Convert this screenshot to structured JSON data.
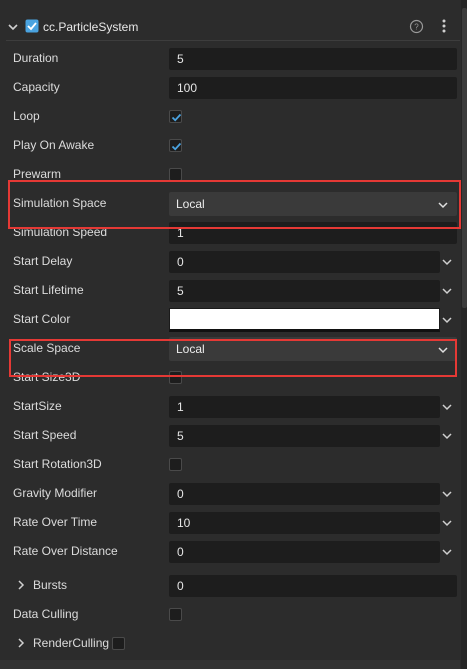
{
  "component": {
    "title": "cc.ParticleSystem",
    "enabled": true
  },
  "icons": {
    "collapse": "chevron-down-icon",
    "help": "help-circle-icon",
    "more": "vertical-ellipsis-icon"
  },
  "colors": {
    "highlight": "#e53935",
    "check": "#4aa3e0",
    "field_bg": "#1d1d1d",
    "select_bg": "#3a3a3a"
  },
  "props": {
    "duration": {
      "label": "Duration",
      "value": "5"
    },
    "capacity": {
      "label": "Capacity",
      "value": "100"
    },
    "loop": {
      "label": "Loop",
      "checked": true
    },
    "play_on_awake": {
      "label": "Play On Awake",
      "checked": true
    },
    "prewarm": {
      "label": "Prewarm",
      "checked": false
    },
    "simulation_space": {
      "label": "Simulation Space",
      "value": "Local"
    },
    "simulation_speed": {
      "label": "Simulation Speed",
      "value": "1"
    },
    "start_delay": {
      "label": "Start Delay",
      "value": "0"
    },
    "start_lifetime": {
      "label": "Start Lifetime",
      "value": "5"
    },
    "start_color": {
      "label": "Start Color",
      "value": "#ffffff"
    },
    "scale_space": {
      "label": "Scale Space",
      "value": "Local"
    },
    "start_size_3d": {
      "label": "Start Size3D",
      "checked": false
    },
    "start_size": {
      "label": "StartSize",
      "value": "1"
    },
    "start_speed": {
      "label": "Start Speed",
      "value": "5"
    },
    "start_rotation_3d": {
      "label": "Start Rotation3D",
      "checked": false
    },
    "gravity_modifier": {
      "label": "Gravity Modifier",
      "value": "0"
    },
    "rate_over_time": {
      "label": "Rate Over Time",
      "value": "10"
    },
    "rate_over_distance": {
      "label": "Rate Over Distance",
      "value": "0"
    },
    "bursts": {
      "label": "Bursts",
      "value": "0"
    },
    "data_culling": {
      "label": "Data Culling",
      "checked": false
    },
    "render_culling": {
      "label": "RenderCulling",
      "checked": false
    }
  }
}
